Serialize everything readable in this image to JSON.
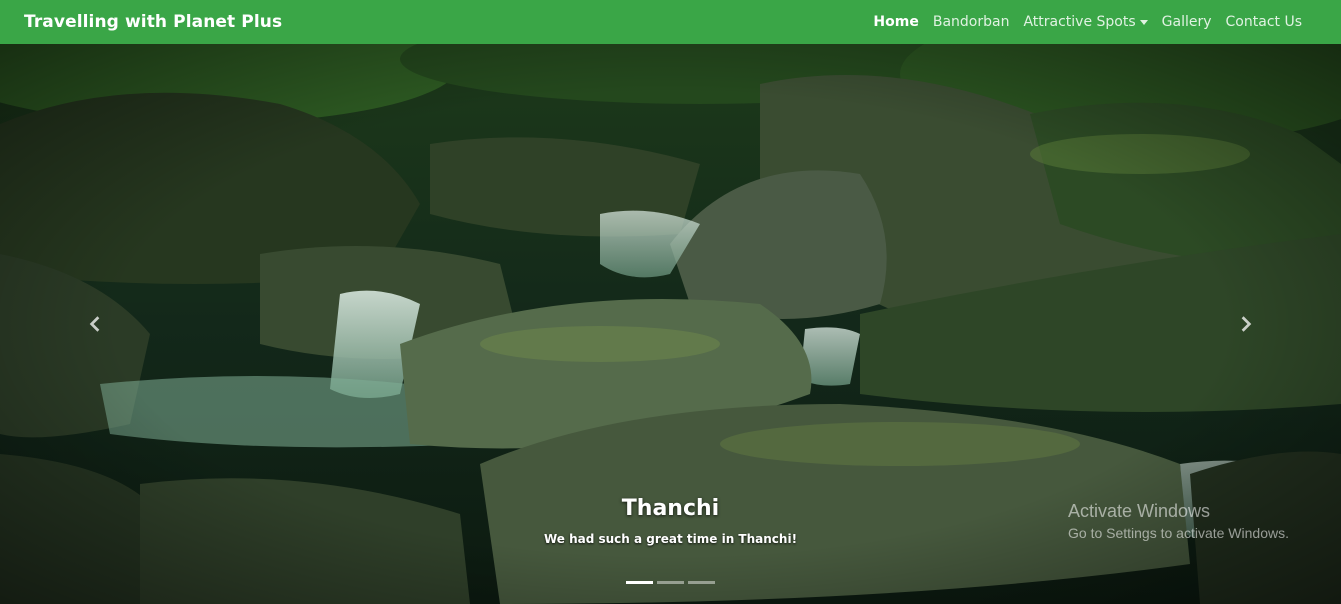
{
  "navbar": {
    "brand": "Travelling with Planet Plus",
    "items": [
      {
        "label": "Home",
        "active": true
      },
      {
        "label": "Bandorban",
        "active": false
      },
      {
        "label": "Attractive Spots",
        "active": false,
        "dropdown": true
      },
      {
        "label": "Gallery",
        "active": false
      },
      {
        "label": "Contact Us",
        "active": false
      }
    ],
    "color": "#3aa647"
  },
  "carousel": {
    "slide": {
      "title": "Thanchi",
      "text": "We had such a great time in Thanchi!",
      "image": "forest-stream-rocks"
    },
    "indicators": {
      "count": 3,
      "active_index": 0
    },
    "prev_icon": "chevron-left-icon",
    "next_icon": "chevron-right-icon"
  },
  "watermark": {
    "title": "Activate Windows",
    "subtitle": "Go to Settings to activate Windows."
  }
}
